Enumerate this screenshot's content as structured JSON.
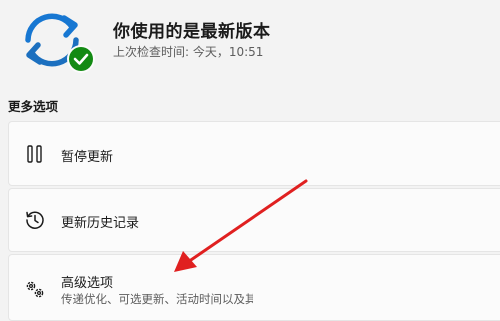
{
  "status": {
    "title": "你使用的是最新版本",
    "last_checked": "上次检查时间: 今天，10:51"
  },
  "more_options": {
    "heading": "更多选项",
    "items": [
      {
        "label": "暂停更新"
      },
      {
        "label": "更新历史记录"
      },
      {
        "label": "高级选项",
        "description": "传递优化、可选更新、活动时间以及其"
      }
    ]
  },
  "colors": {
    "accent": "#0067c0",
    "success": "#0f7b0f",
    "annotation_arrow": "#e02020"
  }
}
